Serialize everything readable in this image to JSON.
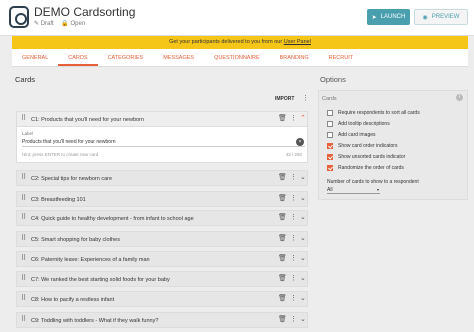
{
  "header": {
    "title": "DEMO Cardsorting",
    "status_draft": "✎ Draft",
    "status_open": "🔒 Open",
    "launch_label": "LAUNCH",
    "preview_label": "PREVIEW"
  },
  "banner": {
    "text": "Get your participants delivered to you from our",
    "link": "User Panel"
  },
  "tabs": [
    "GENERAL",
    "CARDS",
    "CATEGORIES",
    "MESSAGES",
    "QUESTIONNAIRE",
    "BRANDING",
    "RECRUIT"
  ],
  "cards": {
    "title": "Cards",
    "import_label": "IMPORT",
    "items": [
      "C1: Products that you'll need for your newborn",
      "C2: Special tips for newborn care",
      "C3: Breastfeeding 101",
      "C4: Quick guide to healthy development - from infant to school age",
      "C5: Smart shopping for baby clothes",
      "C6: Paternity leave: Experiences of a family man",
      "C7: We ranked the best starting solid foods for your baby",
      "C8: How to pacify a restless infant",
      "C9: Toddling with toddlers - What if they walk funny?"
    ],
    "editor": {
      "label": "Label",
      "value": "Products that you'll need for your newborn",
      "hint": "Hint: press ENTER to create new card",
      "count": "42 / 250"
    }
  },
  "options": {
    "title": "Options",
    "section_label": "Cards",
    "rows": [
      {
        "label": "Require respondents to sort all cards",
        "checked": false
      },
      {
        "label": "Add tooltip descriptions",
        "checked": false
      },
      {
        "label": "Add card images",
        "checked": false
      },
      {
        "label": "Show card order indicators",
        "checked": true
      },
      {
        "label": "Show unsorted cards indicator",
        "checked": true
      },
      {
        "label": "Randomize the order of cards",
        "checked": true
      }
    ],
    "num_label": "Number of cards to show to a respondent",
    "num_value": "All"
  },
  "colors": {
    "accent": "#e5603b",
    "launch": "#4a9fae",
    "banner": "#f5c518"
  }
}
